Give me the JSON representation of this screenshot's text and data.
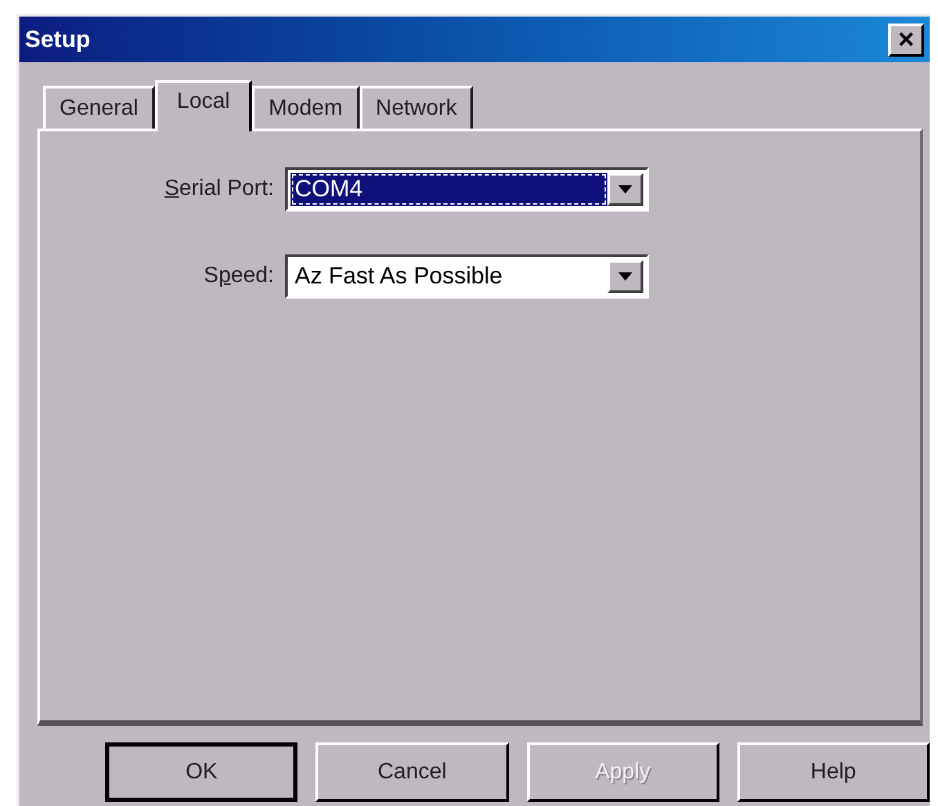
{
  "window": {
    "title": "Setup",
    "close": "×"
  },
  "tabs": [
    {
      "label": "General",
      "selected": false
    },
    {
      "label": "Local",
      "selected": true
    },
    {
      "label": "Modem",
      "selected": false
    },
    {
      "label": "Network",
      "selected": false
    }
  ],
  "fields": [
    {
      "access_key": "S",
      "label_after": "erial Port:",
      "value": "COM4",
      "focused": true
    },
    {
      "label_before": "S",
      "access_key": "p",
      "label_after": "eed:",
      "value": "Az Fast As Possible",
      "focused": false
    }
  ],
  "buttons": [
    {
      "label": "OK",
      "default": true,
      "disabled": false
    },
    {
      "label": "Cancel",
      "default": false,
      "disabled": false
    },
    {
      "label": "Apply",
      "default": false,
      "disabled": true
    },
    {
      "label": "Help",
      "default": false,
      "disabled": false
    }
  ]
}
